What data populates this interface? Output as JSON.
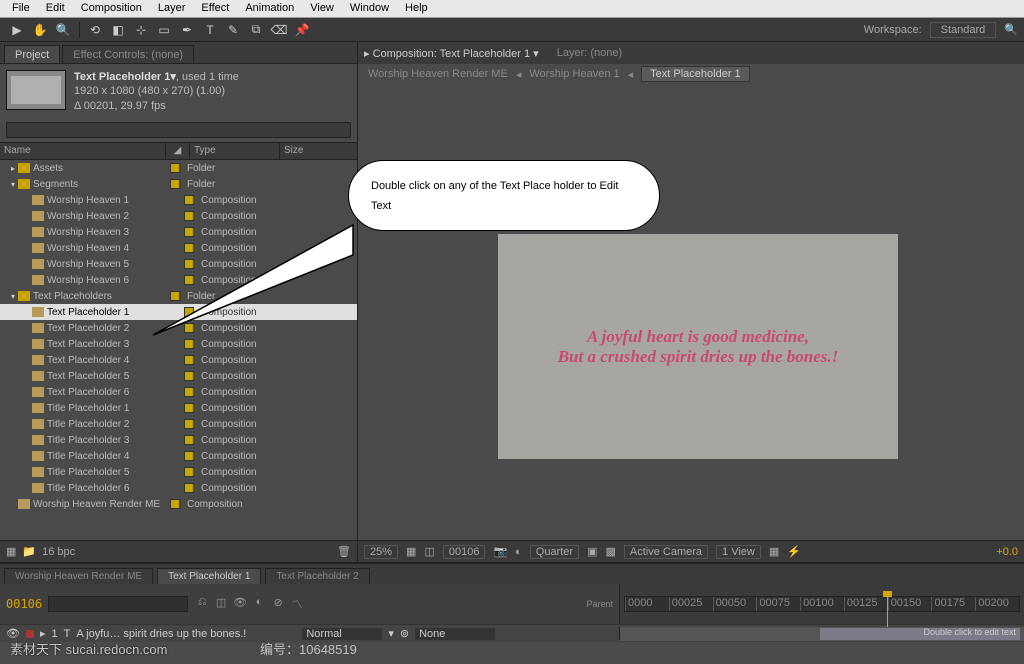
{
  "menu": [
    "File",
    "Edit",
    "Composition",
    "Layer",
    "Effect",
    "Animation",
    "View",
    "Window",
    "Help"
  ],
  "workspace": {
    "label": "Workspace:",
    "value": "Standard"
  },
  "panels": {
    "project": "Project",
    "effect": "Effect Controls: (none)"
  },
  "projInfo": {
    "name": "Text Placeholder 1▾",
    "used": ", used 1 time",
    "dim": "1920 x 1080  (480 x 270) (1.00)",
    "dur": "Δ 00201, 29.97 fps"
  },
  "projHead": {
    "name": "Name",
    "type": "Type",
    "size": "Size"
  },
  "tree": [
    {
      "d": 0,
      "arrow": "▸",
      "icon": "folder",
      "name": "Assets",
      "type": "Folder"
    },
    {
      "d": 0,
      "arrow": "▾",
      "icon": "folder",
      "name": "Segments",
      "type": "Folder"
    },
    {
      "d": 1,
      "icon": "comp",
      "name": "Worship Heaven 1",
      "type": "Composition"
    },
    {
      "d": 1,
      "icon": "comp",
      "name": "Worship Heaven 2",
      "type": "Composition"
    },
    {
      "d": 1,
      "icon": "comp",
      "name": "Worship Heaven 3",
      "type": "Composition"
    },
    {
      "d": 1,
      "icon": "comp",
      "name": "Worship Heaven 4",
      "type": "Composition"
    },
    {
      "d": 1,
      "icon": "comp",
      "name": "Worship Heaven 5",
      "type": "Composition"
    },
    {
      "d": 1,
      "icon": "comp",
      "name": "Worship Heaven 6",
      "type": "Composition"
    },
    {
      "d": 0,
      "arrow": "▾",
      "icon": "folder",
      "name": "Text Placeholders",
      "type": "Folder"
    },
    {
      "d": 1,
      "icon": "comp",
      "name": "Text Placeholder 1",
      "type": "Composition",
      "sel": true
    },
    {
      "d": 1,
      "icon": "comp",
      "name": "Text Placeholder 2",
      "type": "Composition"
    },
    {
      "d": 1,
      "icon": "comp",
      "name": "Text Placeholder 3",
      "type": "Composition"
    },
    {
      "d": 1,
      "icon": "comp",
      "name": "Text Placeholder 4",
      "type": "Composition"
    },
    {
      "d": 1,
      "icon": "comp",
      "name": "Text Placeholder 5",
      "type": "Composition"
    },
    {
      "d": 1,
      "icon": "comp",
      "name": "Text Placeholder 6",
      "type": "Composition"
    },
    {
      "d": 1,
      "icon": "comp",
      "name": "Title Placeholder 1",
      "type": "Composition"
    },
    {
      "d": 1,
      "icon": "comp",
      "name": "Title Placeholder 2",
      "type": "Composition"
    },
    {
      "d": 1,
      "icon": "comp",
      "name": "Title Placeholder 3",
      "type": "Composition"
    },
    {
      "d": 1,
      "icon": "comp",
      "name": "Title Placeholder 4",
      "type": "Composition"
    },
    {
      "d": 1,
      "icon": "comp",
      "name": "Title Placeholder 5",
      "type": "Composition"
    },
    {
      "d": 1,
      "icon": "comp",
      "name": "Title Placeholder 6",
      "type": "Composition"
    },
    {
      "d": 0,
      "icon": "comp",
      "name": "Worship Heaven Render ME",
      "type": "Composition"
    }
  ],
  "projFoot": {
    "bpc": "16 bpc"
  },
  "comp": {
    "title": "Composition: Text Placeholder 1  ▾",
    "layer": "Layer: (none)"
  },
  "bc": {
    "a": "Worship Heaven Render ME",
    "b": "Worship Heaven 1",
    "c": "Text Placeholder 1"
  },
  "canvas": {
    "l1": "A joyful heart is good medicine,",
    "l2": "But a crushed spirit dries up the bones.!"
  },
  "viewFoot": {
    "zoom": "25%",
    "tc": "00106",
    "res": "Quarter",
    "cam": "Active Camera",
    "view": "1 View",
    "exp": "+0.0"
  },
  "tlTabs": [
    "Worship Heaven Render ME",
    "Text Placeholder 1",
    "Text Placeholder 2"
  ],
  "tlTc": "00106",
  "ruler": [
    "0000",
    "00025",
    "00050",
    "00075",
    "00100",
    "00125",
    "00150",
    "00175",
    "00200"
  ],
  "layer": {
    "num": "1",
    "name": "A joyfu… spirit dries up the bones.!",
    "mode": "Normal",
    "par": "None",
    "hint": "Double click to edit text"
  },
  "callout": "Double click on any of the Text Place holder to Edit Text",
  "wm": {
    "site": "素材天下 sucai.redocn.com",
    "id": "编号：10648519"
  }
}
